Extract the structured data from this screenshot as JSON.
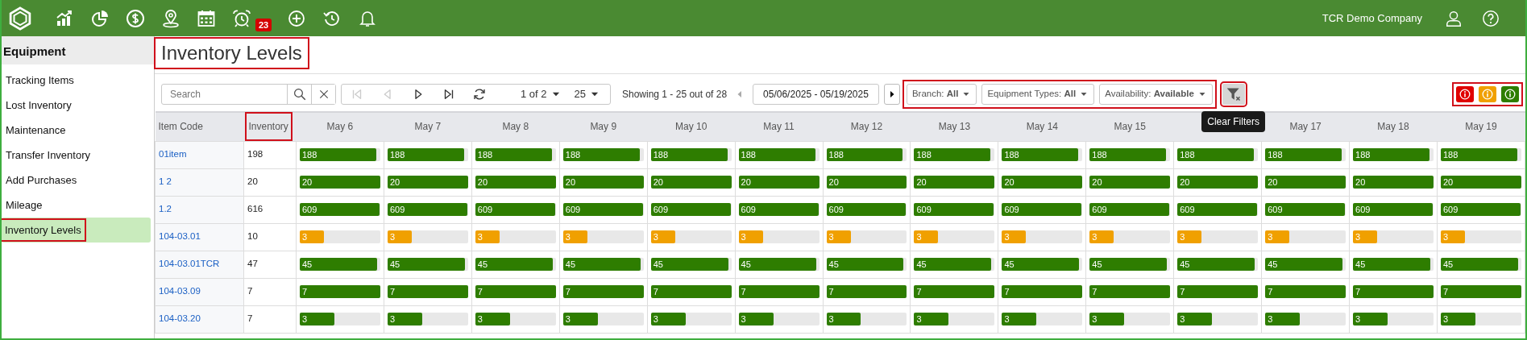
{
  "app_bar": {
    "nav_icons": [
      {
        "kind": "logo"
      },
      {
        "kind": "chart"
      },
      {
        "kind": "pie"
      },
      {
        "kind": "dollar"
      },
      {
        "kind": "pin"
      },
      {
        "kind": "calendar"
      },
      {
        "kind": "alarm",
        "badge": "23"
      },
      {
        "kind": "plus"
      },
      {
        "kind": "history"
      },
      {
        "kind": "bell"
      }
    ],
    "company": "TCR Demo Company",
    "right_icons": [
      {
        "kind": "user"
      },
      {
        "kind": "help"
      }
    ]
  },
  "sidebar": {
    "title": "Equipment",
    "items": [
      {
        "label": "Tracking Items",
        "selected": false,
        "highlighted": false
      },
      {
        "label": "Lost Inventory",
        "selected": false,
        "highlighted": false
      },
      {
        "label": "Maintenance",
        "selected": false,
        "highlighted": false
      },
      {
        "label": "Transfer Inventory",
        "selected": false,
        "highlighted": false
      },
      {
        "label": "Add Purchases",
        "selected": false,
        "highlighted": false
      },
      {
        "label": "Mileage",
        "selected": false,
        "highlighted": false
      },
      {
        "label": "Inventory Levels",
        "selected": true,
        "highlighted": true
      }
    ]
  },
  "page_title": {
    "text": "Inventory Levels",
    "highlighted": true
  },
  "toolbar": {
    "search": {
      "placeholder": "Search"
    },
    "pager_buttons": [
      {
        "kind": "first",
        "disabled": true
      },
      {
        "kind": "prev",
        "disabled": true
      },
      {
        "kind": "next",
        "disabled": false
      },
      {
        "kind": "last",
        "disabled": false
      },
      {
        "kind": "refresh",
        "disabled": false
      }
    ],
    "page": "1 of 2",
    "page_size": "25",
    "showing": "Showing 1 - 25 out of 28",
    "date_prev": {
      "disabled": true
    },
    "date_range": "05/06/2025 - 05/19/2025",
    "date_next": {
      "disabled": false
    },
    "filters_highlighted": true,
    "filters": [
      {
        "label": "Branch:",
        "value": "All"
      },
      {
        "label": "Equipment Types:",
        "value": "All"
      },
      {
        "label": "Availability:",
        "value": "Available"
      }
    ],
    "clear_filters": {
      "tooltip": "Clear Filters",
      "highlighted": true
    },
    "legend": {
      "highlighted": true,
      "items": [
        {
          "color": "#e00000"
        },
        {
          "color": "#f0a000"
        },
        {
          "color": "#2e7d00"
        }
      ]
    }
  },
  "table": {
    "item_code_header": {
      "label": "Item Code",
      "highlighted": false
    },
    "inventory_header": {
      "label": "Inventory",
      "highlighted": true
    },
    "columns": [
      {
        "kind": "date",
        "label": "May 6"
      },
      {
        "kind": "date",
        "label": "May 7"
      },
      {
        "kind": "date",
        "label": "May 8"
      },
      {
        "kind": "date",
        "label": "May 9"
      },
      {
        "kind": "date",
        "label": "May 10"
      },
      {
        "kind": "date",
        "label": "May 11"
      },
      {
        "kind": "date",
        "label": "May 12"
      },
      {
        "kind": "date",
        "label": "May 13"
      },
      {
        "kind": "date",
        "label": "May 14"
      },
      {
        "kind": "date",
        "label": "May 15"
      },
      {
        "kind": "covered"
      },
      {
        "kind": "date",
        "label": "May 17"
      },
      {
        "kind": "date",
        "label": "May 18"
      },
      {
        "kind": "date",
        "label": "May 19"
      }
    ],
    "rows": [
      {
        "item_code": "01item",
        "inventory": "198",
        "color": "#2e7d00",
        "cells": [
          {
            "text": "188",
            "level": 0.95
          },
          {
            "text": "188",
            "level": 0.95
          },
          {
            "text": "188",
            "level": 0.95
          },
          {
            "text": "188",
            "level": 0.95
          },
          {
            "text": "188",
            "level": 0.95
          },
          {
            "text": "188",
            "level": 0.95
          },
          {
            "text": "188",
            "level": 0.95
          },
          {
            "text": "188",
            "level": 0.95
          },
          {
            "text": "188",
            "level": 0.95
          },
          {
            "text": "188",
            "level": 0.95
          },
          {
            "text": "188",
            "level": 0.95
          },
          {
            "text": "188",
            "level": 0.95
          },
          {
            "text": "188",
            "level": 0.95
          },
          {
            "text": "188",
            "level": 0.95
          }
        ]
      },
      {
        "item_code": "1 2",
        "inventory": "20",
        "color": "#2e7d00",
        "cells": [
          {
            "text": "20",
            "level": 1
          },
          {
            "text": "20",
            "level": 1
          },
          {
            "text": "20",
            "level": 1
          },
          {
            "text": "20",
            "level": 1
          },
          {
            "text": "20",
            "level": 1
          },
          {
            "text": "20",
            "level": 1
          },
          {
            "text": "20",
            "level": 1
          },
          {
            "text": "20",
            "level": 1
          },
          {
            "text": "20",
            "level": 1
          },
          {
            "text": "20",
            "level": 1
          },
          {
            "text": "20",
            "level": 1
          },
          {
            "text": "20",
            "level": 1
          },
          {
            "text": "20",
            "level": 1
          },
          {
            "text": "20",
            "level": 1
          }
        ]
      },
      {
        "item_code": "1.2",
        "inventory": "616",
        "color": "#2e7d00",
        "cells": [
          {
            "text": "609",
            "level": 0.99
          },
          {
            "text": "609",
            "level": 0.99
          },
          {
            "text": "609",
            "level": 0.99
          },
          {
            "text": "609",
            "level": 0.99
          },
          {
            "text": "609",
            "level": 0.99
          },
          {
            "text": "609",
            "level": 0.99
          },
          {
            "text": "609",
            "level": 0.99
          },
          {
            "text": "609",
            "level": 0.99
          },
          {
            "text": "609",
            "level": 0.99
          },
          {
            "text": "609",
            "level": 0.99
          },
          {
            "text": "609",
            "level": 0.99
          },
          {
            "text": "609",
            "level": 0.99
          },
          {
            "text": "609",
            "level": 0.99
          },
          {
            "text": "609",
            "level": 0.99
          }
        ]
      },
      {
        "item_code": "104-03.01",
        "inventory": "10",
        "color": "#f0a000",
        "cells": [
          {
            "text": "3",
            "level": 0.3
          },
          {
            "text": "3",
            "level": 0.3
          },
          {
            "text": "3",
            "level": 0.3
          },
          {
            "text": "3",
            "level": 0.3
          },
          {
            "text": "3",
            "level": 0.3
          },
          {
            "text": "3",
            "level": 0.3
          },
          {
            "text": "3",
            "level": 0.3
          },
          {
            "text": "3",
            "level": 0.3
          },
          {
            "text": "3",
            "level": 0.3
          },
          {
            "text": "3",
            "level": 0.3
          },
          {
            "text": "3",
            "level": 0.3
          },
          {
            "text": "3",
            "level": 0.3
          },
          {
            "text": "3",
            "level": 0.3
          },
          {
            "text": "3",
            "level": 0.3
          }
        ]
      },
      {
        "item_code": "104-03.01TCR",
        "inventory": "47",
        "color": "#2e7d00",
        "cells": [
          {
            "text": "45",
            "level": 0.96
          },
          {
            "text": "45",
            "level": 0.96
          },
          {
            "text": "45",
            "level": 0.96
          },
          {
            "text": "45",
            "level": 0.96
          },
          {
            "text": "45",
            "level": 0.96
          },
          {
            "text": "45",
            "level": 0.96
          },
          {
            "text": "45",
            "level": 0.96
          },
          {
            "text": "45",
            "level": 0.96
          },
          {
            "text": "45",
            "level": 0.96
          },
          {
            "text": "45",
            "level": 0.96
          },
          {
            "text": "45",
            "level": 0.96
          },
          {
            "text": "45",
            "level": 0.96
          },
          {
            "text": "45",
            "level": 0.96
          },
          {
            "text": "45",
            "level": 0.96
          }
        ]
      },
      {
        "item_code": "104-03.09",
        "inventory": "7",
        "color": "#2e7d00",
        "cells": [
          {
            "text": "7",
            "level": 1
          },
          {
            "text": "7",
            "level": 1
          },
          {
            "text": "7",
            "level": 1
          },
          {
            "text": "7",
            "level": 1
          },
          {
            "text": "7",
            "level": 1
          },
          {
            "text": "7",
            "level": 1
          },
          {
            "text": "7",
            "level": 1
          },
          {
            "text": "7",
            "level": 1
          },
          {
            "text": "7",
            "level": 1
          },
          {
            "text": "7",
            "level": 1
          },
          {
            "text": "7",
            "level": 1
          },
          {
            "text": "7",
            "level": 1
          },
          {
            "text": "7",
            "level": 1
          },
          {
            "text": "7",
            "level": 1
          }
        ]
      },
      {
        "item_code": "104-03.20",
        "inventory": "7",
        "color": "#2e7d00",
        "cells": [
          {
            "text": "3",
            "level": 0.43
          },
          {
            "text": "3",
            "level": 0.43
          },
          {
            "text": "3",
            "level": 0.43
          },
          {
            "text": "3",
            "level": 0.43
          },
          {
            "text": "3",
            "level": 0.43
          },
          {
            "text": "3",
            "level": 0.43
          },
          {
            "text": "3",
            "level": 0.43
          },
          {
            "text": "3",
            "level": 0.43
          },
          {
            "text": "3",
            "level": 0.43
          },
          {
            "text": "3",
            "level": 0.43
          },
          {
            "text": "3",
            "level": 0.43
          },
          {
            "text": "3",
            "level": 0.43
          },
          {
            "text": "3",
            "level": 0.43
          },
          {
            "text": "3",
            "level": 0.43
          }
        ]
      }
    ]
  }
}
